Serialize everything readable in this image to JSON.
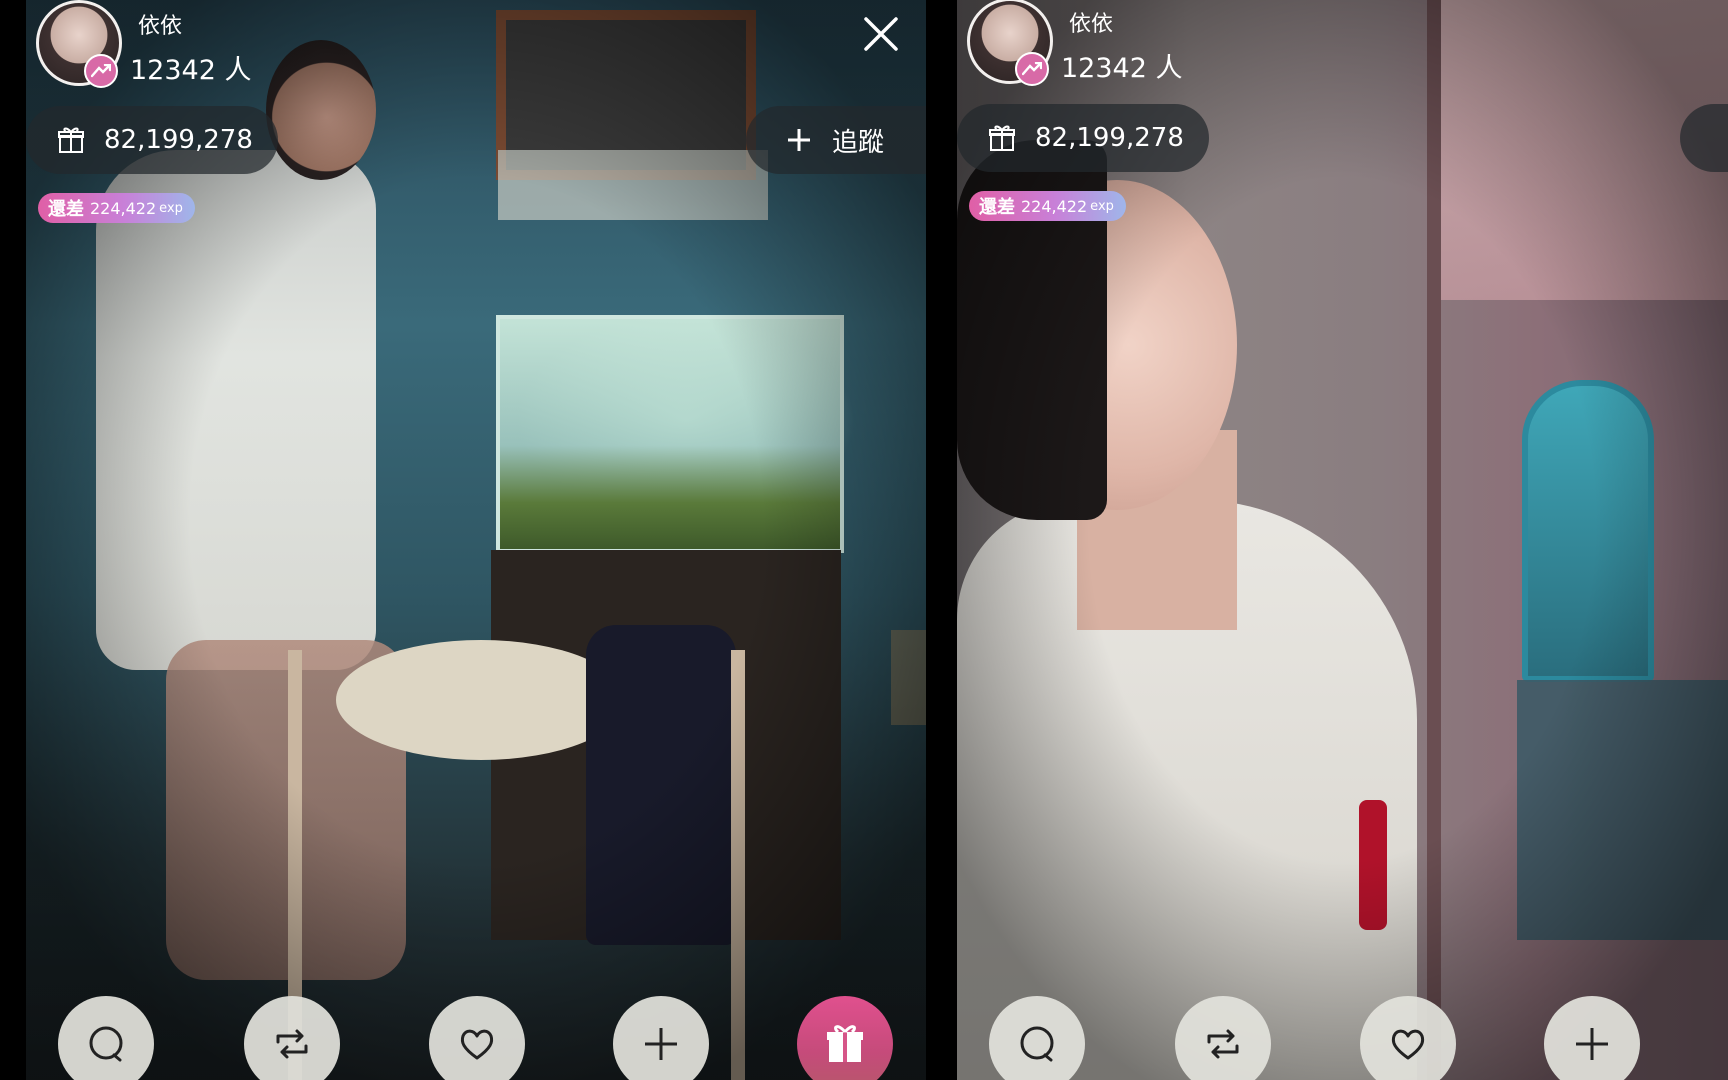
{
  "streams": [
    {
      "host": {
        "name": "依依",
        "viewers": "12342 人",
        "avatar_icon": "host-avatar"
      },
      "gifts_total": "82,199,278",
      "exp": {
        "prefix": "還差",
        "value": "224,422",
        "unit": "exp"
      },
      "follow_label": "追蹤",
      "actions": [
        "comment-icon",
        "share-icon",
        "heart-icon",
        "plus-icon",
        "gift-icon"
      ]
    },
    {
      "host": {
        "name": "依依",
        "viewers": "12342 人",
        "avatar_icon": "host-avatar"
      },
      "gifts_total": "82,199,278",
      "exp": {
        "prefix": "還差",
        "value": "224,422",
        "unit": "exp"
      },
      "actions": [
        "comment-icon",
        "share-icon",
        "heart-icon",
        "plus-icon"
      ]
    }
  ],
  "colors": {
    "pill_bg": "#23282d",
    "badge": "#d86aa7",
    "exp_start": "#e05fa6",
    "exp_end": "#9fb6ea",
    "gift_button": "#e0508e"
  }
}
